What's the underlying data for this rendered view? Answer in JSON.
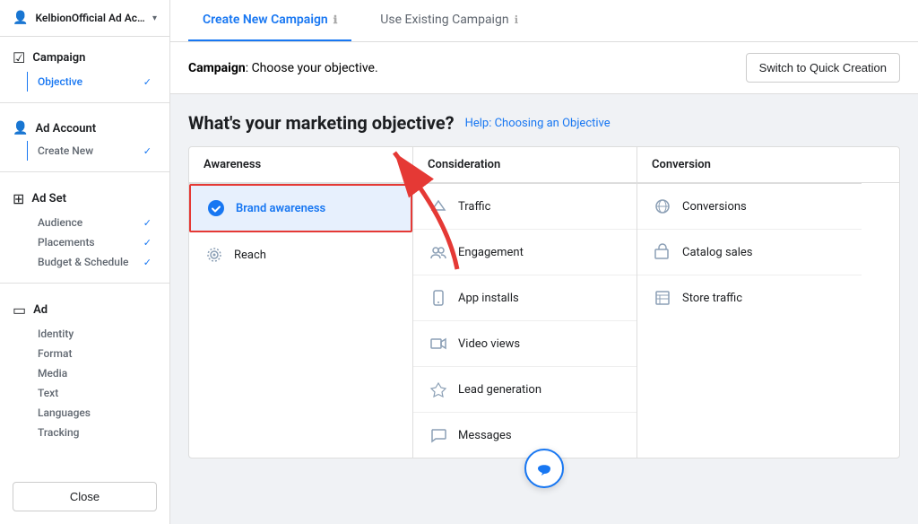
{
  "sidebar": {
    "account_name": "KelbionOfficial Ad Account...",
    "sections": [
      {
        "id": "campaign",
        "icon": "☑",
        "title": "Campaign",
        "items": [
          {
            "label": "Objective",
            "active": true,
            "checked": true
          }
        ]
      },
      {
        "id": "ad_account",
        "icon": "👤",
        "title": "Ad Account",
        "items": [
          {
            "label": "Create New",
            "active": false,
            "checked": true
          }
        ]
      },
      {
        "id": "ad_set",
        "icon": "⊞",
        "title": "Ad Set",
        "items": [
          {
            "label": "Audience",
            "active": false,
            "checked": true
          },
          {
            "label": "Placements",
            "active": false,
            "checked": true
          },
          {
            "label": "Budget & Schedule",
            "active": false,
            "checked": true
          }
        ]
      },
      {
        "id": "ad",
        "icon": "▭",
        "title": "Ad",
        "items": [
          {
            "label": "Identity",
            "active": false,
            "checked": false
          },
          {
            "label": "Format",
            "active": false,
            "checked": false
          },
          {
            "label": "Media",
            "active": false,
            "checked": false
          },
          {
            "label": "Text",
            "active": false,
            "checked": false
          },
          {
            "label": "Languages",
            "active": false,
            "checked": false
          },
          {
            "label": "Tracking",
            "active": false,
            "checked": false
          }
        ]
      }
    ],
    "close_button": "Close"
  },
  "tabs": {
    "create_new": "Create New Campaign",
    "use_existing": "Use Existing Campaign"
  },
  "banner": {
    "label": "Campaign",
    "text": ": Choose your objective.",
    "quick_creation": "Switch to Quick Creation"
  },
  "objective_section": {
    "title": "What's your marketing objective?",
    "help_link": "Help: Choosing an Objective",
    "columns": [
      {
        "header": "Awareness",
        "items": [
          {
            "id": "brand_awareness",
            "label": "Brand awareness",
            "icon": "✔",
            "selected": true
          },
          {
            "id": "reach",
            "label": "Reach",
            "icon": "✦",
            "selected": false
          }
        ]
      },
      {
        "header": "Consideration",
        "items": [
          {
            "id": "traffic",
            "label": "Traffic",
            "icon": "▷",
            "selected": false
          },
          {
            "id": "engagement",
            "label": "Engagement",
            "icon": "👥",
            "selected": false
          },
          {
            "id": "app_installs",
            "label": "App installs",
            "icon": "📱",
            "selected": false
          },
          {
            "id": "video_views",
            "label": "Video views",
            "icon": "🎥",
            "selected": false
          },
          {
            "id": "lead_generation",
            "label": "Lead generation",
            "icon": "▽",
            "selected": false
          },
          {
            "id": "messages",
            "label": "Messages",
            "icon": "💬",
            "selected": false
          }
        ]
      },
      {
        "header": "Conversion",
        "items": [
          {
            "id": "conversions",
            "label": "Conversions",
            "icon": "🌐",
            "selected": false
          },
          {
            "id": "catalog_sales",
            "label": "Catalog sales",
            "icon": "🛒",
            "selected": false
          },
          {
            "id": "store_traffic",
            "label": "Store traffic",
            "icon": "📋",
            "selected": false
          }
        ]
      }
    ]
  },
  "float_button": {
    "icon": "📢"
  }
}
